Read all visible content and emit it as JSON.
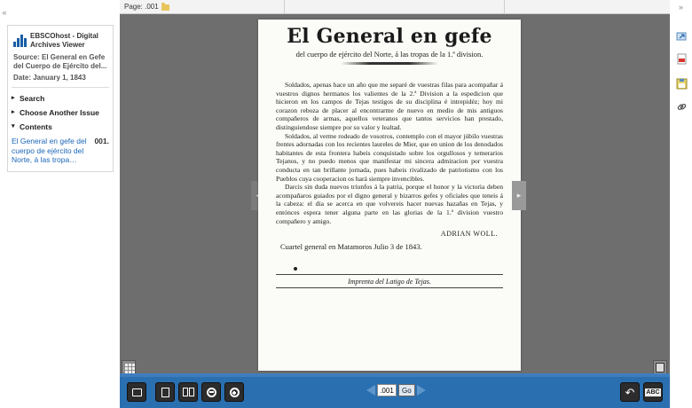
{
  "left_collapse": "«",
  "right_collapse": "»",
  "sidebar": {
    "app_title": "EBSCOhost - Digital Archives Viewer",
    "source": "Source: El General en Gefe del Cuerpo de Ejército del...",
    "date": "Date: January 1, 1843",
    "nav": [
      {
        "label": "Search",
        "icon": "triangle-right"
      },
      {
        "label": "Choose Another Issue",
        "icon": "triangle-right"
      },
      {
        "label": "Contents",
        "icon": "triangle-down"
      }
    ],
    "contents_link": "El General en gefe del cuerpo de ejército del Norte, á las tropa…",
    "contents_page": "001."
  },
  "viewer": {
    "page_label": "Page: .001",
    "page_input": ".001",
    "go_label": "Go",
    "colors": {
      "background": "#6e6e6e",
      "toolbar": "#2a6fb0"
    }
  },
  "document": {
    "title": "El General en gefe",
    "subtitle": "del cuerpo de ejército del Norte, á las tropas de la 1.ª division.",
    "paragraphs": [
      "Soldados, apenas hace un año que me separé de vuestras filas para acompañar á vuestros dignos hermanos los valientes de la 2.ª Division a la espedicion que hicieron en los campos de Tejas testigos de su disciplina é intrepidéz; hoy mi corazon reboza de placer al encontrarme de nuevo en medio de mis antiguos compañeros de armas, aquellos veteranos que tantos servicios han prestado, distinguiendose siempre por su valor y lealtad.",
      "Soldados, al verme rodeado de vosotros, contemplo con el mayor júbilo vuestras frentes adornadas con los recientes laureles de Mier, que en union de los denodados habitantes de esta frontera habeis conquistado sobre los orgullosos y temerarios Tejanos, y no puedo menos que manifestar mi sincera admiracion por vuestra conducta en tan brillante jornada, pues habeis rivalizado de patriotismo con los Pueblos cuya cooperacion os hará siempre invencibles.",
      "Darcis sin duda nuevos triunfos á la patria, porque el honor y la victoria deben acompañaros guiados por el digno general y bizarros gefes y oficiales que teneis á la cabeza: el dia se acerca en que volvereis hacer nuevas hazañas en Tejas, y entónces espera tener alguna parte en las glorias de la 1.ª division vuestro compañero y amigo."
    ],
    "signature": "ADRIAN WOLL.",
    "place_date": "Cuartel general en Matamoros Julio 3 de 1843.",
    "imprint": "Imprenta del Latigo de Tejas."
  },
  "icons": {
    "left_panel_logo": "ebsco-logo-icon",
    "toolbar": [
      "fullscreen-icon",
      "single-page-icon",
      "two-page-icon",
      "zoom-out-icon",
      "zoom-in-icon",
      "rotate-icon",
      "text-abc-icon"
    ],
    "right_column": [
      "share-icon",
      "pdf-icon",
      "save-icon",
      "link-icon"
    ]
  }
}
